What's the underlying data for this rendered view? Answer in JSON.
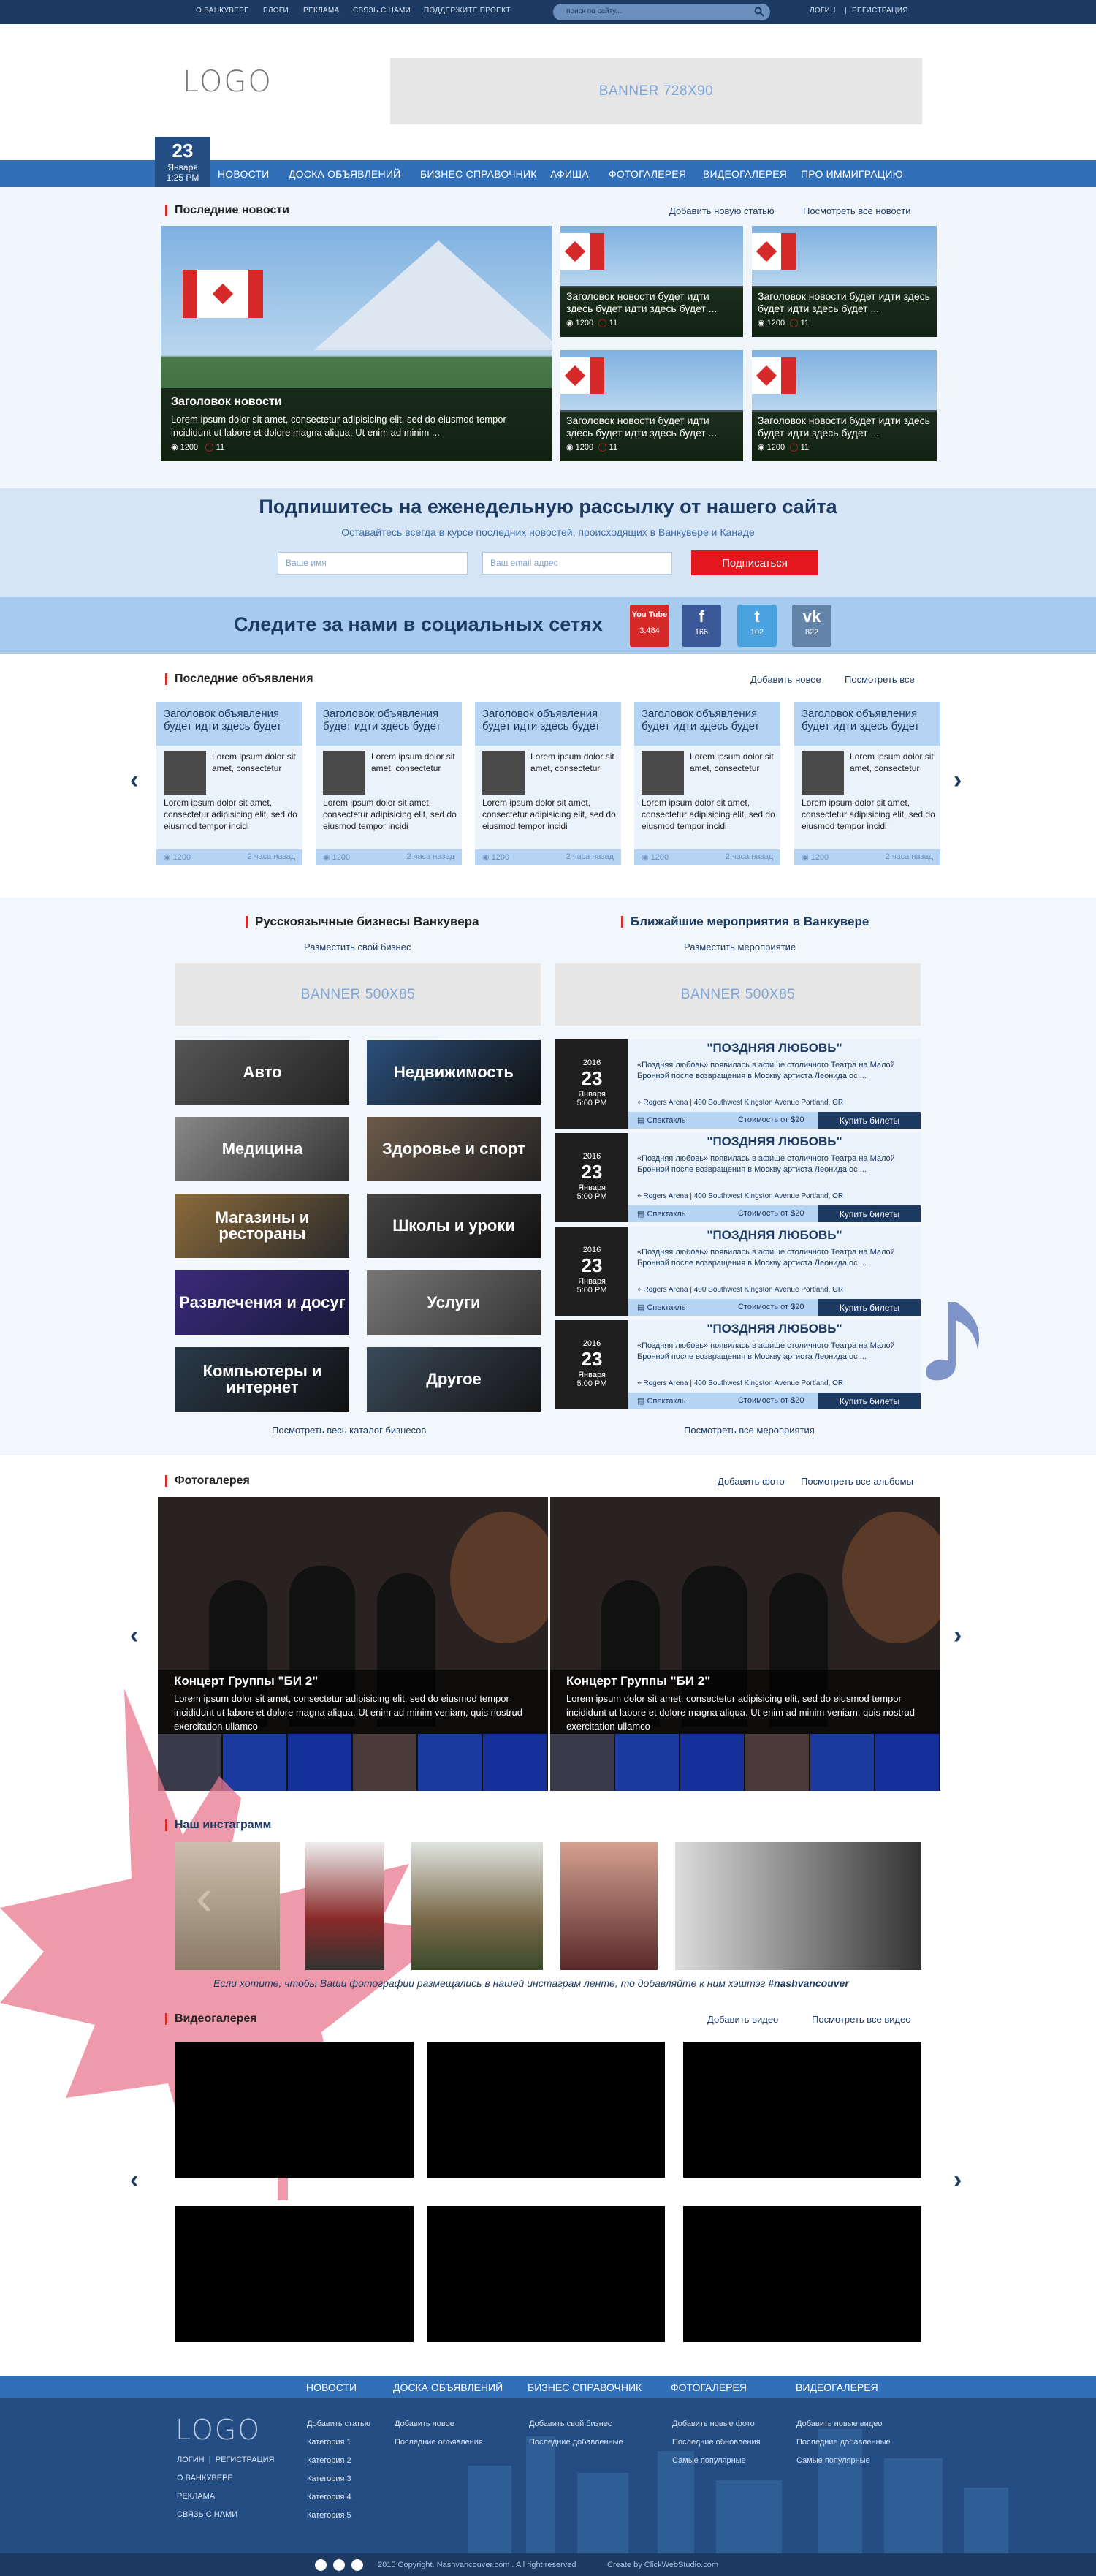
{
  "top_nav": {
    "links": [
      "О ВАНКУВЕРЕ",
      "БЛОГИ",
      "РЕКЛАМА",
      "СВЯЗЬ С НАМИ",
      "ПОДДЕРЖИТЕ ПРОЕКТ"
    ],
    "search_placeholder": "поиск по сайту...",
    "login": "ЛОГИН",
    "register": "РЕГИСТРАЦИЯ"
  },
  "header": {
    "logo": "LOGO",
    "banner": "BANNER 728X90"
  },
  "date": {
    "day": "23",
    "month": "Января",
    "time": "1:25 PM"
  },
  "main_nav": [
    "НОВОСТИ",
    "ДОСКА ОБЪЯВЛЕНИЙ",
    "БИЗНЕС СПРАВОЧНИК",
    "АФИША",
    "ФОТОГАЛЕРЕЯ",
    "ВИДЕОГАЛЕРЕЯ",
    "ПРО ИММИГРАЦИЮ"
  ],
  "news": {
    "title": "Последние новости",
    "add_link": "Добавить новую статью",
    "all_link": "Посмотреть все новости",
    "main": {
      "headline": "Заголовок новости",
      "text": "Lorem ipsum dolor sit amet, consectetur adipisicing elit, sed do eiusmod tempor incididunt ut labore et dolore magna aliqua. Ut enim ad minim ...",
      "views": "1200",
      "comments": "11"
    },
    "small": [
      {
        "headline": "Заголовок новости будет идти здесь будет идти здесь будет ...",
        "views": "1200",
        "comments": "11"
      },
      {
        "headline": "Заголовок новости будет идти здесь будет идти здесь будет ...",
        "views": "1200",
        "comments": "11"
      },
      {
        "headline": "Заголовок новости будет идти здесь будет идти здесь будет ...",
        "views": "1200",
        "comments": "11"
      },
      {
        "headline": "Заголовок новости будет идти здесь будет идти здесь будет ...",
        "views": "1200",
        "comments": "11"
      }
    ]
  },
  "subscribe": {
    "title": "Подпишитесь на еженедельную рассылку от нашего сайта",
    "subtitle": "Оставайтесь всегда в курсе последних новостей, происходящих в Ванкувере и Канаде",
    "name_placeholder": "Ваше имя",
    "email_placeholder": "Ваш email адрес",
    "button": "Подписаться"
  },
  "social": {
    "title": "Следите за нами в социальных сетях",
    "buttons": [
      {
        "glyph": "You Tube",
        "count": "3.484",
        "color": "#d62a2a"
      },
      {
        "glyph": "f",
        "count": "166",
        "color": "#3b5998"
      },
      {
        "glyph": "t",
        "count": "102",
        "color": "#4aa3df"
      },
      {
        "glyph": "vk",
        "count": "822",
        "color": "#6383a8"
      }
    ]
  },
  "ads": {
    "title": "Последние объявления",
    "add_link": "Добавить новое",
    "all_link": "Посмотреть все",
    "cards": [
      {
        "title": "Заголовок объявления будет идти здесь будет",
        "text1": "Lorem ipsum dolor sit amet, consectetur",
        "text2": "Lorem ipsum dolor sit amet, consectetur adipisicing elit, sed do eiusmod tempor incidi",
        "views": "1200",
        "time": "2 часа назад"
      },
      {
        "title": "Заголовок объявления будет идти здесь будет",
        "text1": "Lorem ipsum dolor sit amet, consectetur",
        "text2": "Lorem ipsum dolor sit amet, consectetur adipisicing elit, sed do eiusmod tempor incidi",
        "views": "1200",
        "time": "2 часа назад"
      },
      {
        "title": "Заголовок объявления будет идти здесь будет",
        "text1": "Lorem ipsum dolor sit amet, consectetur",
        "text2": "Lorem ipsum dolor sit amet, consectetur adipisicing elit, sed do eiusmod tempor incidi",
        "views": "1200",
        "time": "2 часа назад"
      },
      {
        "title": "Заголовок объявления будет идти здесь будет",
        "text1": "Lorem ipsum dolor sit amet, consectetur",
        "text2": "Lorem ipsum dolor sit amet, consectetur adipisicing elit, sed do eiusmod tempor incidi",
        "views": "1200",
        "time": "2 часа назад"
      },
      {
        "title": "Заголовок объявления будет идти здесь будет",
        "text1": "Lorem ipsum dolor sit amet, consectetur",
        "text2": "Lorem ipsum dolor sit amet, consectetur adipisicing elit, sed do eiusmod tempor incidi",
        "views": "1200",
        "time": "2 часа назад"
      }
    ]
  },
  "business": {
    "title": "Русскоязычные бизнесы Ванкувера",
    "add_link": "Разместить свой бизнес",
    "banner": "BANNER 500X85",
    "tiles": [
      "Авто",
      "Недвижимость",
      "Медицина",
      "Здоровье и спорт",
      "Магазины и рестораны",
      "Школы и уроки",
      "Развлечения и досуг",
      "Услуги",
      "Компьютеры и интернет",
      "Другое"
    ],
    "all_link": "Посмотреть весь каталог бизнесов"
  },
  "events": {
    "title": "Ближайшие мероприятия в Ванкувере",
    "add_link": "Разместить мероприятие",
    "banner": "BANNER 500X85",
    "items": [
      {
        "year": "2016",
        "day": "23",
        "month": "Января",
        "time": "5:00 PM",
        "title": "\"ПОЗДНЯЯ ЛЮБОВЬ\"",
        "desc": "«Поздняя любовь» появилась в афише столичного Театра на Малой Бронной после возвращения в Москву артиста Леонида ос ...",
        "address": "Rogers Arena | 400 Southwest Kingston Avenue Portland, OR",
        "type": "Спектакль",
        "price": "Стоимость от $20",
        "buy": "Купить билеты"
      },
      {
        "year": "2016",
        "day": "23",
        "month": "Января",
        "time": "5:00 PM",
        "title": "\"ПОЗДНЯЯ ЛЮБОВЬ\"",
        "desc": "«Поздняя любовь» появилась в афише столичного Театра на Малой Бронной после возвращения в Москву артиста Леонида ос ...",
        "address": "Rogers Arena | 400 Southwest Kingston Avenue Portland, OR",
        "type": "Спектакль",
        "price": "Стоимость от $20",
        "buy": "Купить билеты"
      },
      {
        "year": "2016",
        "day": "23",
        "month": "Января",
        "time": "5:00 PM",
        "title": "\"ПОЗДНЯЯ ЛЮБОВЬ\"",
        "desc": "«Поздняя любовь» появилась в афише столичного Театра на Малой Бронной после возвращения в Москву артиста Леонида ос ...",
        "address": "Rogers Arena | 400 Southwest Kingston Avenue Portland, OR",
        "type": "Спектакль",
        "price": "Стоимость от $20",
        "buy": "Купить билеты"
      },
      {
        "year": "2016",
        "day": "23",
        "month": "Января",
        "time": "5:00 PM",
        "title": "\"ПОЗДНЯЯ ЛЮБОВЬ\"",
        "desc": "«Поздняя любовь» появилась в афише столичного Театра на Малой Бронной после возвращения в Москву артиста Леонида ос ...",
        "address": "Rogers Arena | 400 Southwest Kingston Avenue Portland, OR",
        "type": "Спектакль",
        "price": "Стоимость от $20",
        "buy": "Купить билеты"
      }
    ],
    "all_link": "Посмотреть все мероприятия"
  },
  "gallery": {
    "title": "Фотогалерея",
    "add_link": "Добавить фото",
    "all_link": "Посмотреть все альбомы",
    "items": [
      {
        "headline": "Концерт Группы \"БИ 2\"",
        "text": "Lorem ipsum dolor sit amet, consectetur adipisicing elit, sed do eiusmod tempor incididunt ut labore et dolore magna aliqua. Ut enim ad minim veniam, quis nostrud exercitation ullamco"
      },
      {
        "headline": "Концерт Группы \"БИ 2\"",
        "text": "Lorem ipsum dolor sit amet, consectetur adipisicing elit, sed do eiusmod tempor incididunt ut labore et dolore magna aliqua. Ut enim ad minim veniam, quis nostrud exercitation ullamco"
      }
    ]
  },
  "instagram": {
    "title": "Наш инстаграмм",
    "note": "Если хотите, чтобы Ваши фотографии размещались в нашей инстаграм ленте, то добавляйте к ним хэштэг",
    "hashtag": "#nashvancouver"
  },
  "video": {
    "title": "Видеогалерея",
    "add_link": "Добавить видео",
    "all_link": "Посмотреть все видео"
  },
  "footer_nav": [
    "НОВОСТИ",
    "ДОСКА ОБЪЯВЛЕНИЙ",
    "БИЗНЕС СПРАВОЧНИК",
    "ФОТОГАЛЕРЕЯ",
    "ВИДЕОГАЛЕРЕЯ"
  ],
  "footer": {
    "logo": "LOGO",
    "login": "ЛОГИН",
    "register": "РЕГИСТРАЦИЯ",
    "links": [
      "О ВАНКУВЕРЕ",
      "РЕКЛАМА",
      "СВЯЗЬ С НАМИ"
    ],
    "col1": [
      "Добавить статью",
      "Категория 1",
      "Категория 2",
      "Категория 3",
      "Категория 4",
      "Категория 5"
    ],
    "col2": [
      "Добавить новое",
      "Последние объявления"
    ],
    "col3": [
      "Добавить свой бизнес",
      "Последние добавленные"
    ],
    "col4": [
      "Добавить новые фото",
      "Последние обновления",
      "Самые популярные"
    ],
    "col5": [
      "Добавить новые видео",
      "Последние добавленные",
      "Самые популярные"
    ],
    "copyright": "2015 Copyright. Nashvancouver.com . All right reserved",
    "created": "Create by ClickWebStudio.com"
  },
  "colors": {
    "navy": "#1d3a62",
    "blue": "#316fb8",
    "red": "#d62a2a",
    "light": "#d6e6f7"
  }
}
